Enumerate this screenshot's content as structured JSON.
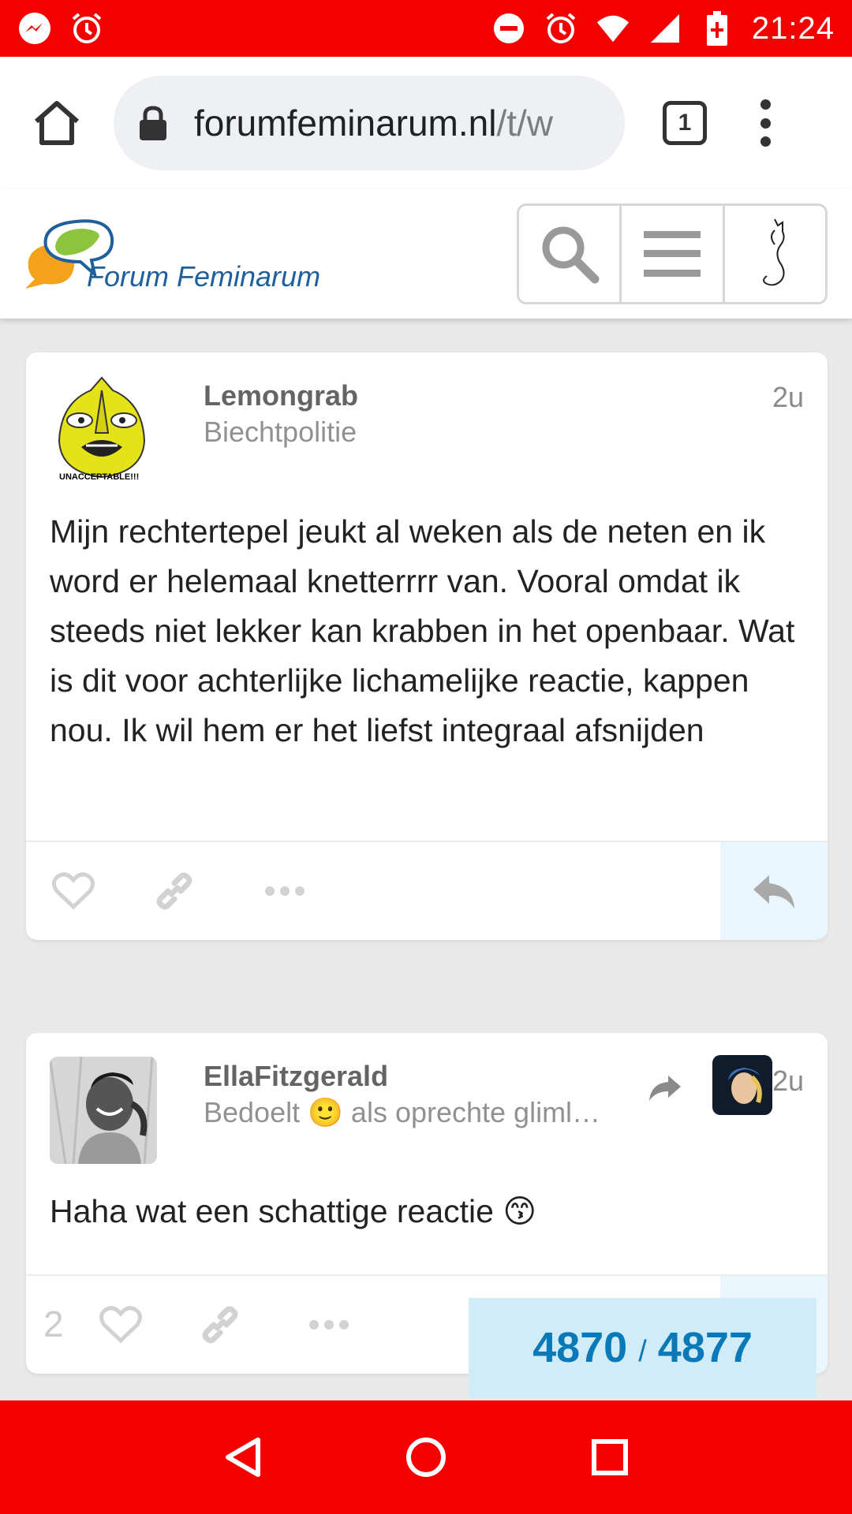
{
  "status_bar": {
    "time": "21:24",
    "left_icons": [
      "messenger-icon",
      "alarm-icon"
    ],
    "right_icons": [
      "do-not-disturb-icon",
      "alarm-icon",
      "wifi-icon",
      "signal-icon",
      "battery-charging-icon"
    ]
  },
  "browser": {
    "url_domain": "forumfeminarum.nl",
    "url_path": "/t/w",
    "tab_count": "1"
  },
  "site": {
    "logo_text": "Forum Feminarum"
  },
  "posts": [
    {
      "username": "Lemongrab",
      "user_title": "Biechtpolitie",
      "age": "2u",
      "avatar_caption": "UNACCEPTABLE!!!",
      "body": "Mijn rechtertepel jeukt al weken als de neten en ik word er helemaal knetterrrr van. Vooral omdat ik steeds niet lekker kan krabben in het openbaar. Wat is dit voor achterlijke lichamelijke reactie, kappen nou. Ik wil hem er het liefst integraal afsnijden"
    },
    {
      "username": "EllaFitzgerald",
      "user_title": "Bedoelt 🙂 als oprechte gliml…",
      "age": "2u",
      "body": "Haha wat een schattige reactie 😙",
      "like_count": "2"
    }
  ],
  "progress": {
    "current": "4870",
    "separator": "/",
    "total": "4877"
  },
  "colors": {
    "status_bar": "#f40000",
    "progress_bg": "#d1ecf9",
    "progress_text": "#0a79b8",
    "reply_bg": "#eaf6fd"
  }
}
